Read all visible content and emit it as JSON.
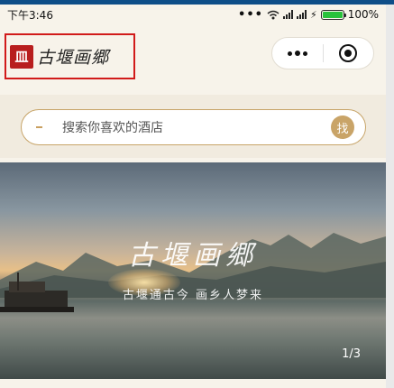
{
  "status_bar": {
    "time": "下午3:46",
    "icons": [
      "dots-icon",
      "wifi-icon",
      "signal-icon",
      "signal-icon",
      "charging-icon",
      "battery-icon"
    ],
    "battery_percent": "100%",
    "battery_level": 1.0
  },
  "header": {
    "logo_mark": "皿",
    "logo_text": "古堰画郷"
  },
  "capsule": {
    "icons": [
      "more-dots-icon",
      "close-target-icon"
    ]
  },
  "search": {
    "placeholder": "搜索你喜欢的酒店",
    "button_label": "找"
  },
  "banner": {
    "title": "古堰画郷",
    "slogan": "古堰通古今  画乡人梦来",
    "pager": "1/3"
  },
  "colors": {
    "accent_gold": "#c9a468",
    "logo_border": "#d11a1a",
    "battery_green": "#28c23b",
    "top_strip": "#0e4e88"
  }
}
